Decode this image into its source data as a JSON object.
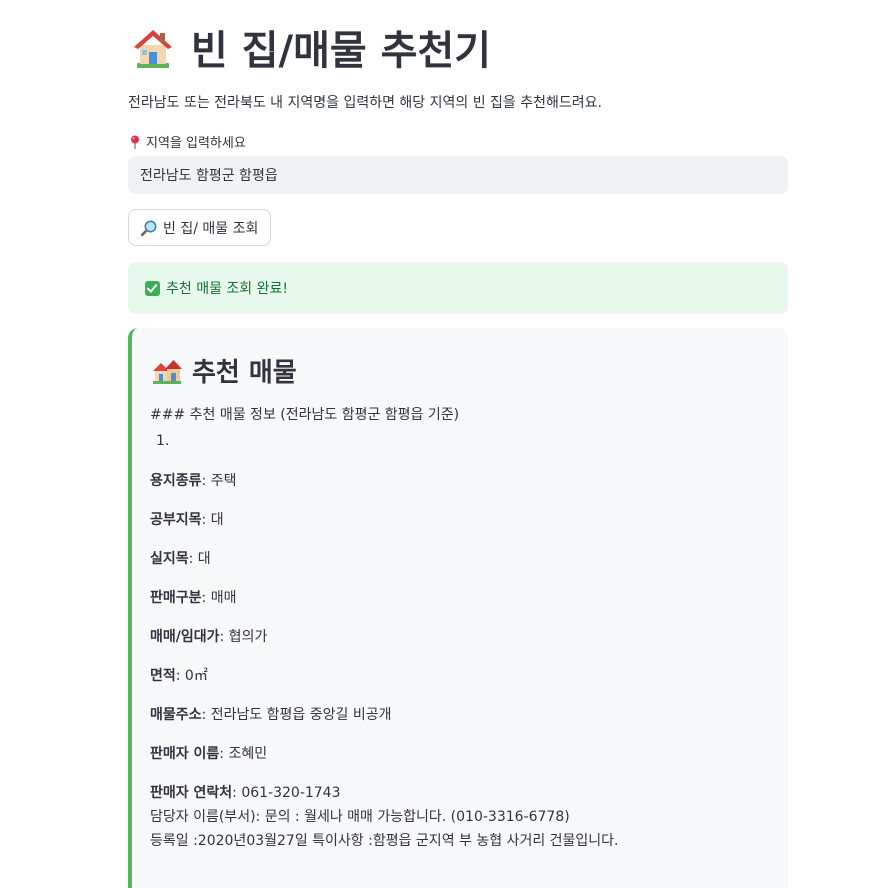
{
  "header": {
    "title": "빈 집/매물 추천기",
    "description": "전라남도 또는 전라북도 내 지역명을 입력하면 해당 지역의 빈 집을 추천해드려요."
  },
  "input": {
    "label": "지역을 입력하세요",
    "value": "전라남도 함평군 함평읍"
  },
  "search_button": {
    "label": "빈 집/ 매물 조회"
  },
  "success": {
    "message": "추천 매물 조회 완료!"
  },
  "result": {
    "title": "추천 매물",
    "intro": "### 추천 매물 정보 (전라남도 함평군 함평읍 기준)",
    "list_number": "1.",
    "fields": [
      {
        "label": "용지종류",
        "value": ": 주택"
      },
      {
        "label": "공부지목",
        "value": ": 대"
      },
      {
        "label": "실지목",
        "value": ": 대"
      },
      {
        "label": "판매구분",
        "value": ": 매매"
      },
      {
        "label": "매매/임대가",
        "value": ": 협의가"
      },
      {
        "label": "면적",
        "value": ": 0㎡"
      },
      {
        "label": "매물주소",
        "value": ": 전라남도 함평읍 중앙길 비공개"
      },
      {
        "label": "판매자 이름",
        "value": ": 조혜민"
      },
      {
        "label": "판매자 연락처",
        "value": ": 061-320-1743"
      }
    ],
    "extra_lines": [
      "담당자 이름(부서): 문의 : 월세나 매매 가능합니다. (010-3316-6778)",
      "등록일 :2020년03월27일 특이사항 :함평읍 군지역 부 농협 사거리 건물입니다."
    ]
  },
  "colors": {
    "accent_border": "#55b561",
    "success_bg": "#e7f8ec",
    "success_text": "#177233",
    "input_bg": "#f0f2f6"
  },
  "icons": {
    "title": "house-emoji-icon",
    "label": "round-pushpin-icon",
    "button": "magnifying-glass-icon",
    "success": "check-mark-button-icon",
    "result": "houses-emoji-icon"
  }
}
